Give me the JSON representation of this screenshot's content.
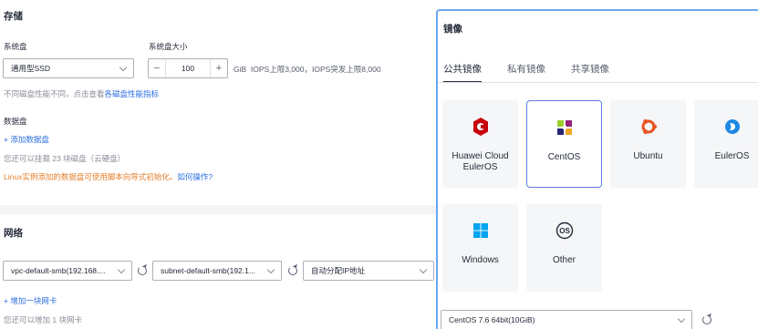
{
  "storage": {
    "title": "存储",
    "system_disk_label": "系统盘",
    "system_disk_size_label": "系统盘大小",
    "disk_type": "通用型SSD",
    "size_minus": "−",
    "size_value": "100",
    "size_plus": "+",
    "size_unit_info": "GiB  IOPS上限3,000，IOPS突发上限8,000",
    "perf_hint_prefix": "不同磁盘性能不同，点击查看",
    "perf_hint_link": "各磁盘性能指标",
    "data_disk_label": "数据盘",
    "add_data_disk": "+ 添加数据盘",
    "data_disk_remaining": "您还可以挂载 23 块磁盘（云硬盘）",
    "linux_warning": "Linux实例添加的数据盘可使用脚本向导式初始化。",
    "linux_warning_link": "如何操作?"
  },
  "network": {
    "title": "网络",
    "vpc": "vpc-default-smb(192.168....",
    "subnet": "subnet-default-smb(192.1...",
    "ip_mode": "自动分配IP地址",
    "add_nic": "+ 增加一块网卡",
    "nic_remaining": "您还可以增加 1 块网卡"
  },
  "image_panel": {
    "title": "镜像",
    "tabs": [
      "公共镜像",
      "私有镜像",
      "共享镜像"
    ],
    "active_tab": 0,
    "cards": [
      {
        "name": "Huawei Cloud\nEulerOS",
        "icon": "huawei-cloud-euleros-icon"
      },
      {
        "name": "CentOS",
        "icon": "centos-icon"
      },
      {
        "name": "Ubuntu",
        "icon": "ubuntu-icon"
      },
      {
        "name": "EulerOS",
        "icon": "euleros-icon"
      },
      {
        "name": "Windows",
        "icon": "windows-icon"
      },
      {
        "name": "Other",
        "icon": "other-os-icon"
      }
    ],
    "selected_card": "CentOS",
    "version": "CentOS 7.6 64bit(10GiB)"
  },
  "colors": {
    "accent": "#2a6ee0",
    "warning": "#e37d29",
    "selected_border": "#5e7ce0"
  }
}
